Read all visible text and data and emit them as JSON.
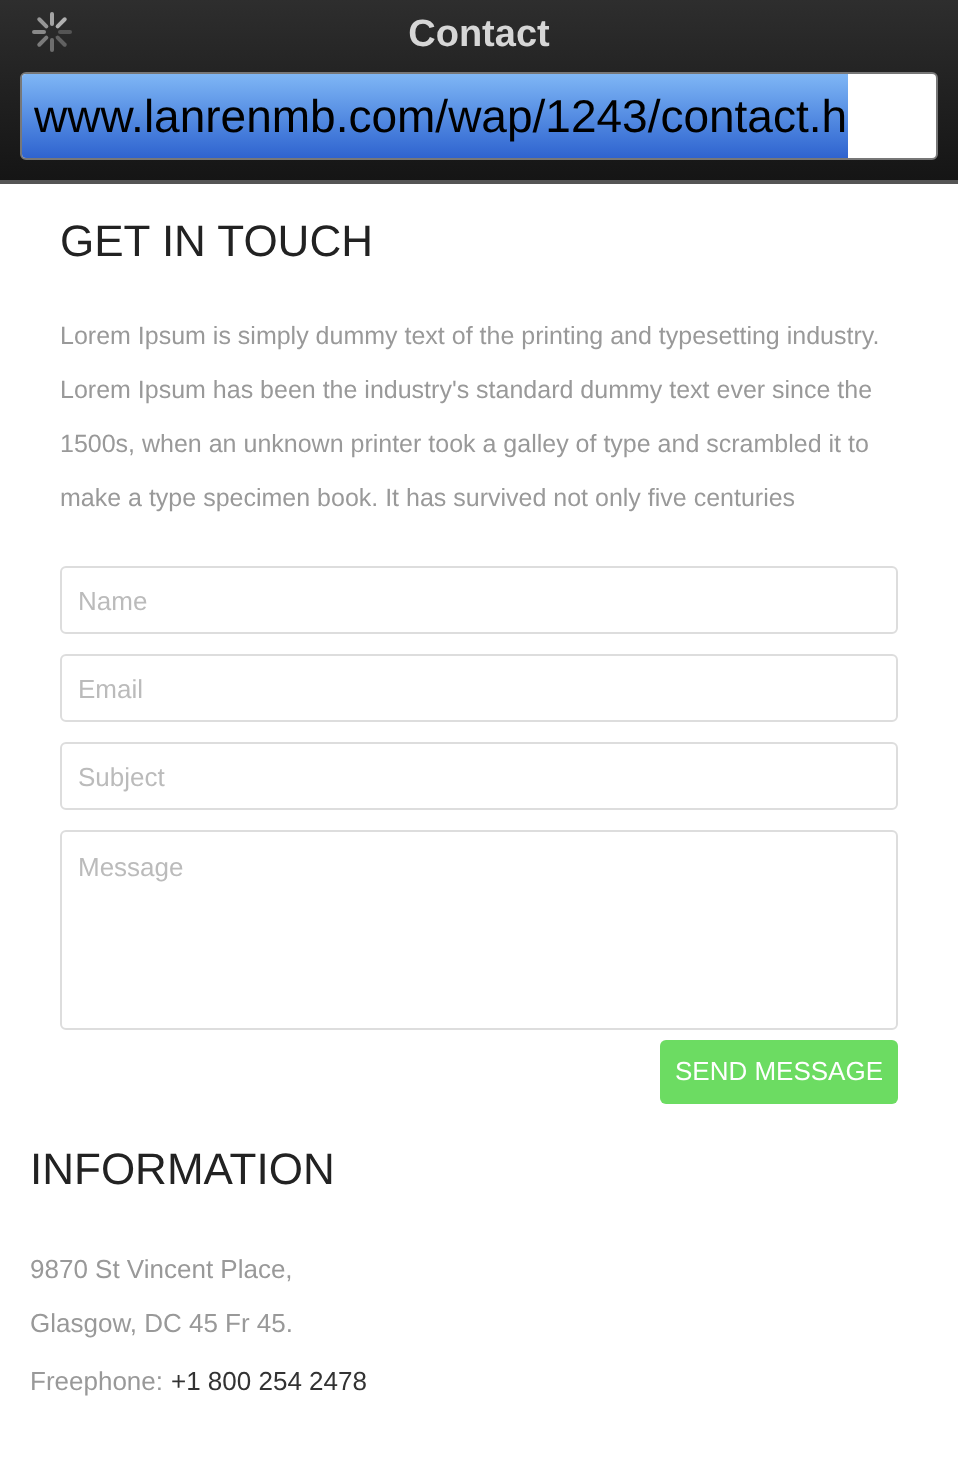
{
  "window": {
    "title": "Contact",
    "url": "www.lanrenmb.com/wap/1243/contact.h"
  },
  "contact": {
    "heading": "GET IN TOUCH",
    "text": "Lorem Ipsum is simply dummy text of the printing and typesetting industry. Lorem Ipsum has been the industry's standard dummy text ever since the 1500s, when an unknown printer took a galley of type and scrambled it to make a type specimen book. It has survived not only five centuries",
    "fields": [
      {
        "kind": "line",
        "placeholder": "Name"
      },
      {
        "kind": "line",
        "placeholder": "Email"
      },
      {
        "kind": "line",
        "placeholder": "Subject"
      },
      {
        "kind": "area",
        "placeholder": "Message"
      }
    ],
    "button": "SEND MESSAGE"
  },
  "information": {
    "heading": "INFORMATION",
    "address": [
      "9870 St Vincent Place,",
      "Glasgow, DC 45 Fr 45."
    ],
    "phone_label": "Freephone:",
    "phone": "+1 800 254 2478"
  }
}
